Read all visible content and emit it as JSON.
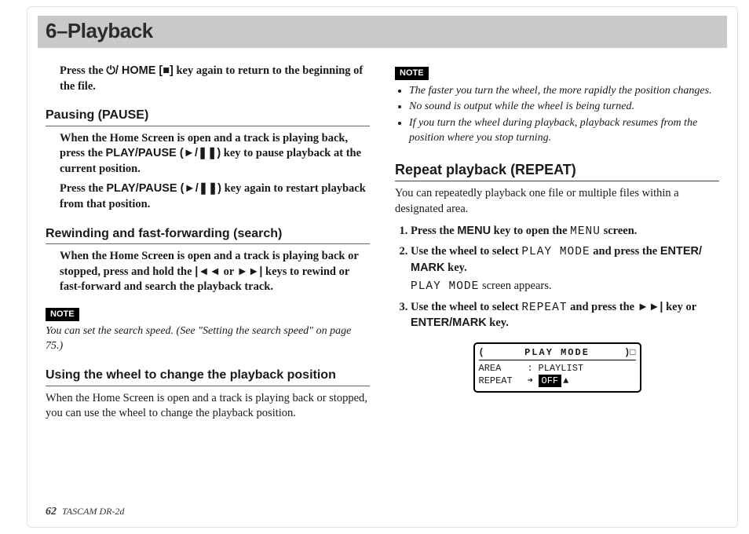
{
  "header": {
    "title": "6–Playback"
  },
  "left": {
    "intro_html": "Press the <span class='key'>⏻/ HOME [■]</span> key again to return to the beginning of the file.",
    "pausing": {
      "heading": "Pausing (PAUSE)",
      "p1_html": "When the Home Screen is open and a track is playing back, press the <span class='key'>PLAY/PAUSE (►/❚❚)</span> key to pause playback at the current position.",
      "p2_html": "Press the <span class='key'>PLAY/PAUSE (►/❚❚)</span> key again to restart playback from that position."
    },
    "search": {
      "heading": "Rewinding and fast-forwarding (search)",
      "p1_html": "When the Home Screen is open and a track is playing back or stopped, press and hold the <span class='key'>|◄◄</span> or <span class='key'>►►|</span> keys to rewind or fast-forward and search the playback track.",
      "note_label": "NOTE",
      "note_body": "You can set the search speed. (See \"Setting the search speed\" on page 75.)"
    },
    "wheel": {
      "heading": "Using the wheel to change the playback position",
      "p1": "When the Home Screen is open and a track is playing back or stopped, you can use the wheel to change the playback position."
    }
  },
  "right": {
    "note_label": "NOTE",
    "notes": [
      "The faster you turn the wheel, the more rapidly the position changes.",
      "No sound is output while the wheel is being turned.",
      "If you turn the wheel during playback, playback resumes from the position where you stop turning."
    ],
    "repeat": {
      "heading": "Repeat playback (REPEAT)",
      "intro": "You can repeatedly playback one file or multiple files within a designated area.",
      "steps": [
        {
          "html": "Press the <span class='key'>MENU</span> key to open the <span class='lcd'>MENU</span> screen."
        },
        {
          "html": "Use the wheel to select <span class='lcd'>PLAY MODE</span> and press the <span class='key'>ENTER/ MARK</span> key.",
          "after_html": "<span class='lcd'>PLAY MODE</span> screen appears."
        },
        {
          "html": "Use the wheel to select <span class='lcd'>REPEAT</span> and press the <span class='key'>►►|</span> key or <span class='key'>ENTER/MARK</span> key."
        }
      ],
      "lcd": {
        "title": "PLAY  MODE",
        "rows": [
          {
            "k": "AREA",
            "sep": ":",
            "v": "PLAYLIST",
            "inv": false
          },
          {
            "k": "REPEAT",
            "sep": "➜",
            "v": "OFF",
            "inv": true,
            "tail": "▲"
          }
        ]
      }
    }
  },
  "footer": {
    "page": "62",
    "model": "TASCAM  DR-2d"
  }
}
